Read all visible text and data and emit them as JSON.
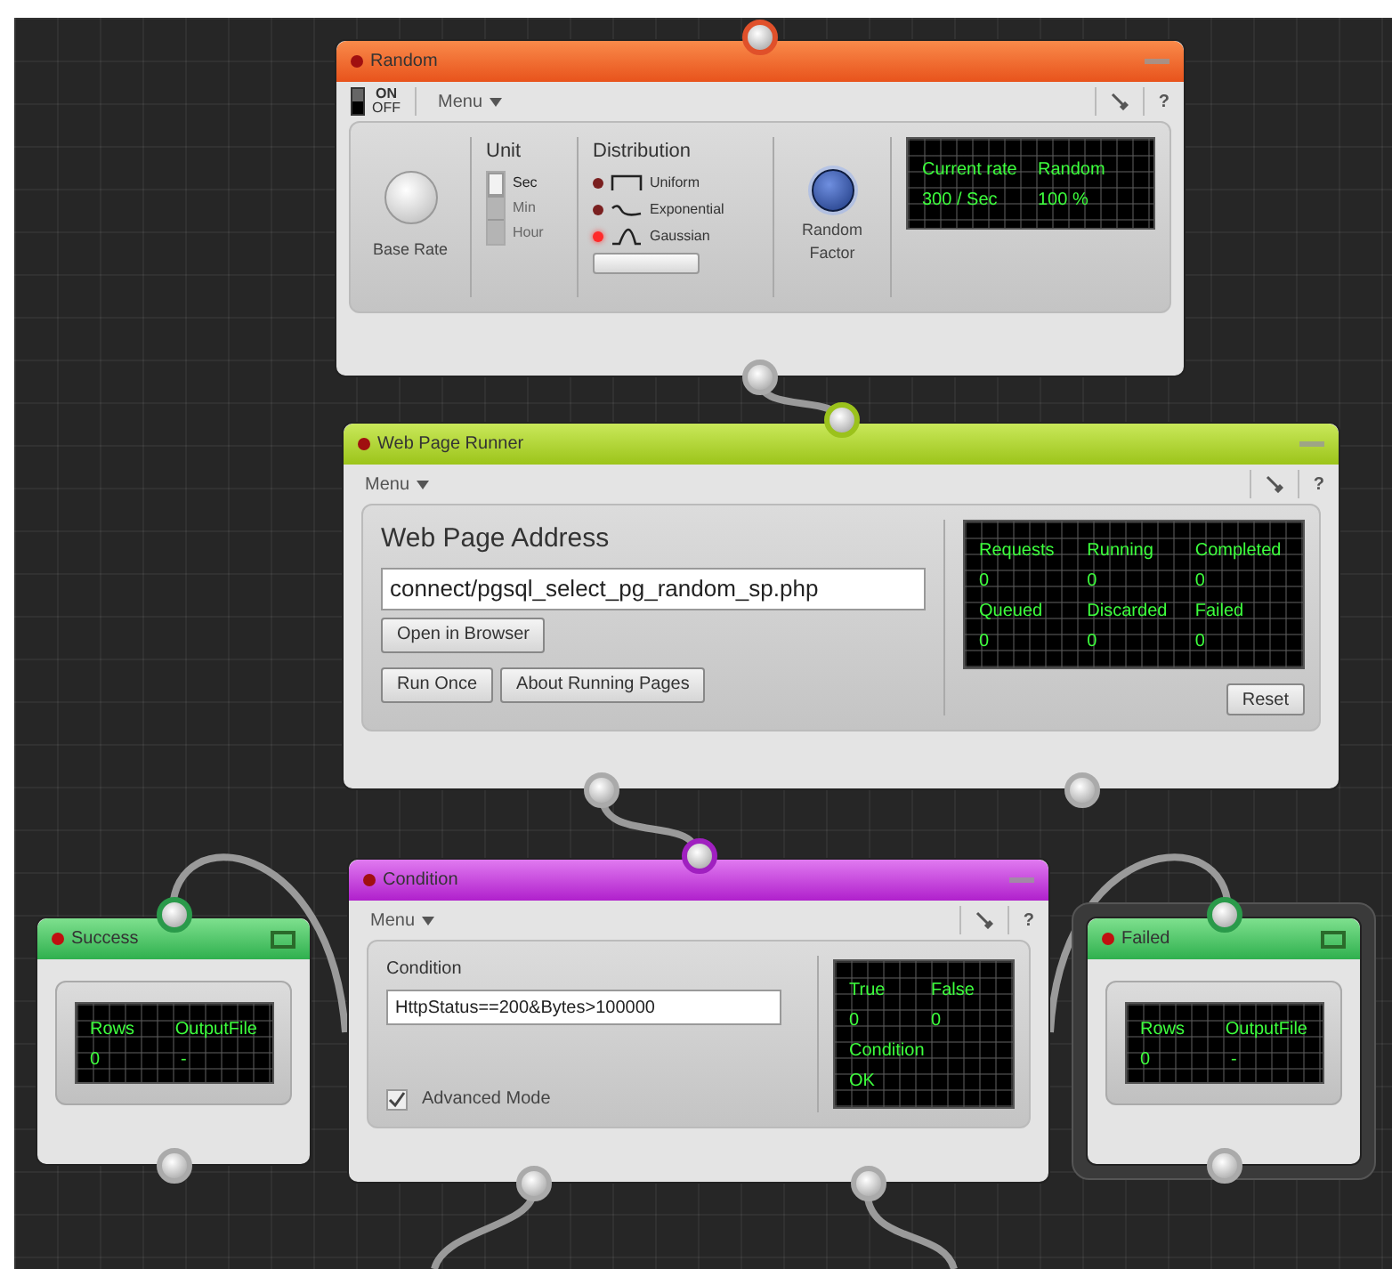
{
  "random_node": {
    "title": "Random",
    "selected": false,
    "power": {
      "on_label": "ON",
      "off_label": "OFF",
      "on": true
    },
    "menu": "Menu",
    "help": "?",
    "base_rate_label": "Base Rate",
    "unit": {
      "title": "Unit",
      "options": [
        {
          "label": "Sec",
          "selected": true
        },
        {
          "label": "Min",
          "selected": false
        },
        {
          "label": "Hour",
          "selected": false
        }
      ]
    },
    "distribution": {
      "title": "Distribution",
      "options": [
        {
          "label": "Uniform",
          "kind": "uniform",
          "selected": false
        },
        {
          "label": "Exponential",
          "kind": "exponential",
          "selected": false
        },
        {
          "label": "Gaussian",
          "kind": "gaussian",
          "selected": true
        }
      ]
    },
    "random_factor_label": "Random Factor",
    "display": [
      [
        "Current rate",
        "Random"
      ],
      [
        "300 / Sec",
        "100 %"
      ]
    ]
  },
  "web_page_runner": {
    "title": "Web Page Runner",
    "selected": false,
    "menu": "Menu",
    "help": "?",
    "address_label": "Web Page Address",
    "address": "connect/pgsql_select_pg_random_sp.php",
    "buttons": [
      "Open in Browser",
      "Run Once",
      "About Running Pages"
    ],
    "display": [
      [
        "Requests",
        "Running",
        "Completed"
      ],
      [
        "0",
        "0",
        "0"
      ],
      [
        "Queued",
        "Discarded",
        "Failed"
      ],
      [
        "0",
        "0",
        "0"
      ]
    ],
    "reset": "Reset"
  },
  "condition_node": {
    "title": "Condition",
    "selected": false,
    "menu": "Menu",
    "help": "?",
    "condition_label": "Condition",
    "condition": "HttpStatus==200&Bytes>100000",
    "advanced_mode": {
      "label": "Advanced Mode",
      "checked": true
    },
    "display": [
      [
        "True",
        "False"
      ],
      [
        "0",
        "0"
      ],
      [
        "Condition"
      ],
      [
        "OK"
      ]
    ]
  },
  "success_node": {
    "title": "Success",
    "selected": false,
    "display": [
      [
        "Rows",
        "OutputFile"
      ],
      [
        "0",
        "-"
      ]
    ]
  },
  "failed_node": {
    "title": "Failed",
    "selected": true,
    "display": [
      [
        "Rows",
        "OutputFile"
      ],
      [
        "0",
        "-"
      ]
    ]
  }
}
